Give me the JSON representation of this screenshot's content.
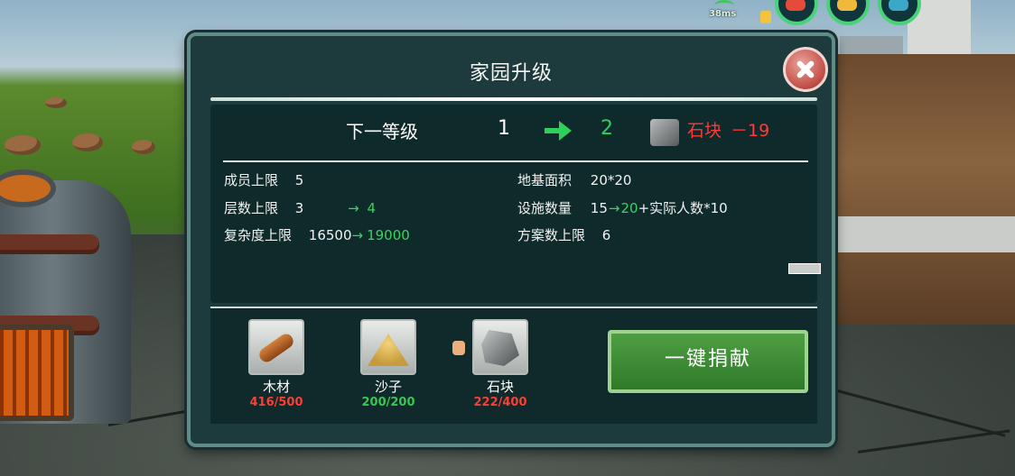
{
  "hud": {
    "ping": "38ms",
    "orb_colors": [
      "#e64a3b",
      "#f1b93a",
      "#3aa9c9"
    ]
  },
  "dialog": {
    "title": "家园升级",
    "close_icon": "close-icon"
  },
  "upgrade": {
    "label": "下一等级",
    "from_level": "1",
    "to_level": "2",
    "cost_item": "石块",
    "cost_value": "－19"
  },
  "stats": {
    "members_label": "成员上限",
    "members_value": "5",
    "floors_label": "层数上限",
    "floors_value": "3",
    "floors_next": "4",
    "complexity_label": "复杂度上限",
    "complexity_value": "16500",
    "complexity_next": "19000",
    "area_label": "地基面积",
    "area_value": "20*20",
    "facilities_label": "设施数量",
    "facilities_value": "15",
    "facilities_next": "20",
    "facilities_suffix": "+实际人数*10",
    "plans_label": "方案数上限",
    "plans_value": "6"
  },
  "resources": [
    {
      "name": "木材",
      "count": "416/500",
      "icon": "wood-log-icon"
    },
    {
      "name": "沙子",
      "count": "200/200",
      "icon": "sand-pile-icon"
    },
    {
      "name": "石块",
      "count": "222/400",
      "icon": "stone-icon"
    }
  ],
  "donate_button": "一键捐献",
  "colors": {
    "panel_bg": "#1d3a3c",
    "upgrade_green": "#2fd05a",
    "deficit_red": "#ff3d34",
    "button_green": "#3f8f36"
  }
}
